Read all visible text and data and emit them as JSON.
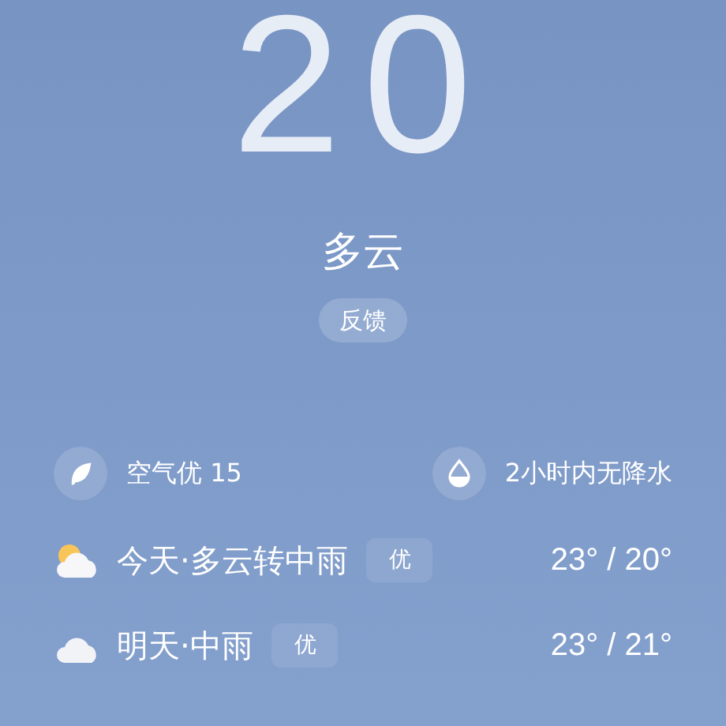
{
  "current": {
    "temperature": "20",
    "condition": "多云",
    "feedback_button": "反馈"
  },
  "info": [
    {
      "kind": "air",
      "label": "空气优 15"
    },
    {
      "kind": "rain",
      "label": "2小时内无降水"
    }
  ],
  "forecast": [
    {
      "kind": "partly-cloudy",
      "label": "今天·多云转中雨",
      "air_quality": "优",
      "temperature": "23° / 20°"
    },
    {
      "kind": "cloudy",
      "label": "明天·中雨",
      "air_quality": "优",
      "temperature": "23° / 21°"
    }
  ]
}
